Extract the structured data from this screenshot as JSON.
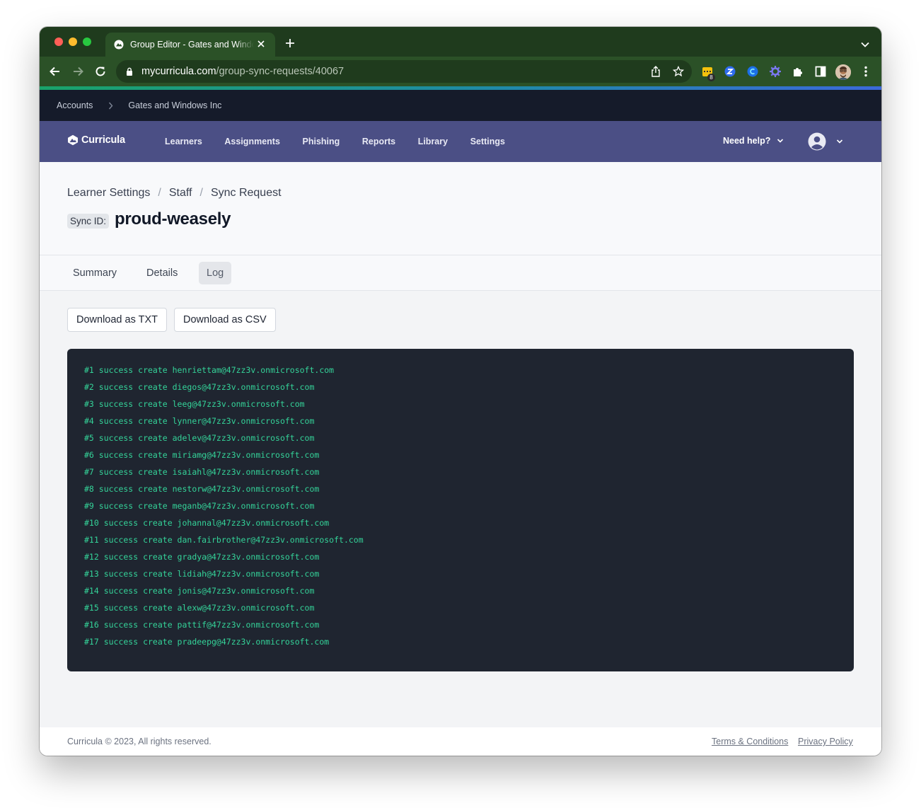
{
  "browser": {
    "tab_title": "Group Editor - Gates and Windows Inc",
    "url_host": "mycurricula.com",
    "url_path": "/group-sync-requests/40067",
    "extension_badge": "8"
  },
  "account_bar": {
    "items": [
      "Accounts",
      "Gates and Windows Inc"
    ]
  },
  "nav": {
    "logo": "Curricula",
    "links": [
      "Learners",
      "Assignments",
      "Phishing",
      "Reports",
      "Library",
      "Settings"
    ],
    "help": "Need help?"
  },
  "header": {
    "breadcrumb": [
      "Learner Settings",
      "Staff",
      "Sync Request"
    ],
    "sync_label": "Sync ID:",
    "sync_id": "proud-weasely"
  },
  "tabs": [
    "Summary",
    "Details",
    "Log"
  ],
  "active_tab": "Log",
  "actions": {
    "download_txt": "Download as TXT",
    "download_csv": "Download as CSV"
  },
  "log": [
    "#1 success create henriettam@47zz3v.onmicrosoft.com",
    "#2 success create diegos@47zz3v.onmicrosoft.com",
    "#3 success create leeg@47zz3v.onmicrosoft.com",
    "#4 success create lynner@47zz3v.onmicrosoft.com",
    "#5 success create adelev@47zz3v.onmicrosoft.com",
    "#6 success create miriamg@47zz3v.onmicrosoft.com",
    "#7 success create isaiahl@47zz3v.onmicrosoft.com",
    "#8 success create nestorw@47zz3v.onmicrosoft.com",
    "#9 success create meganb@47zz3v.onmicrosoft.com",
    "#10 success create johannal@47zz3v.onmicrosoft.com",
    "#11 success create dan.fairbrother@47zz3v.onmicrosoft.com",
    "#12 success create gradya@47zz3v.onmicrosoft.com",
    "#13 success create lidiah@47zz3v.onmicrosoft.com",
    "#14 success create jonis@47zz3v.onmicrosoft.com",
    "#15 success create alexw@47zz3v.onmicrosoft.com",
    "#16 success create pattif@47zz3v.onmicrosoft.com",
    "#17 success create pradeepg@47zz3v.onmicrosoft.com"
  ],
  "footer": {
    "copyright": "Curricula © 2023, All rights reserved.",
    "terms": "Terms & Conditions",
    "privacy": "Privacy Policy"
  },
  "colors": {
    "chrome_frame": "#1f3b1d",
    "chrome_toolbar": "#2b5127",
    "account_bar": "#151b2a",
    "main_nav": "#4b4f85",
    "log_background": "#1f2530",
    "log_text": "#34d399"
  }
}
